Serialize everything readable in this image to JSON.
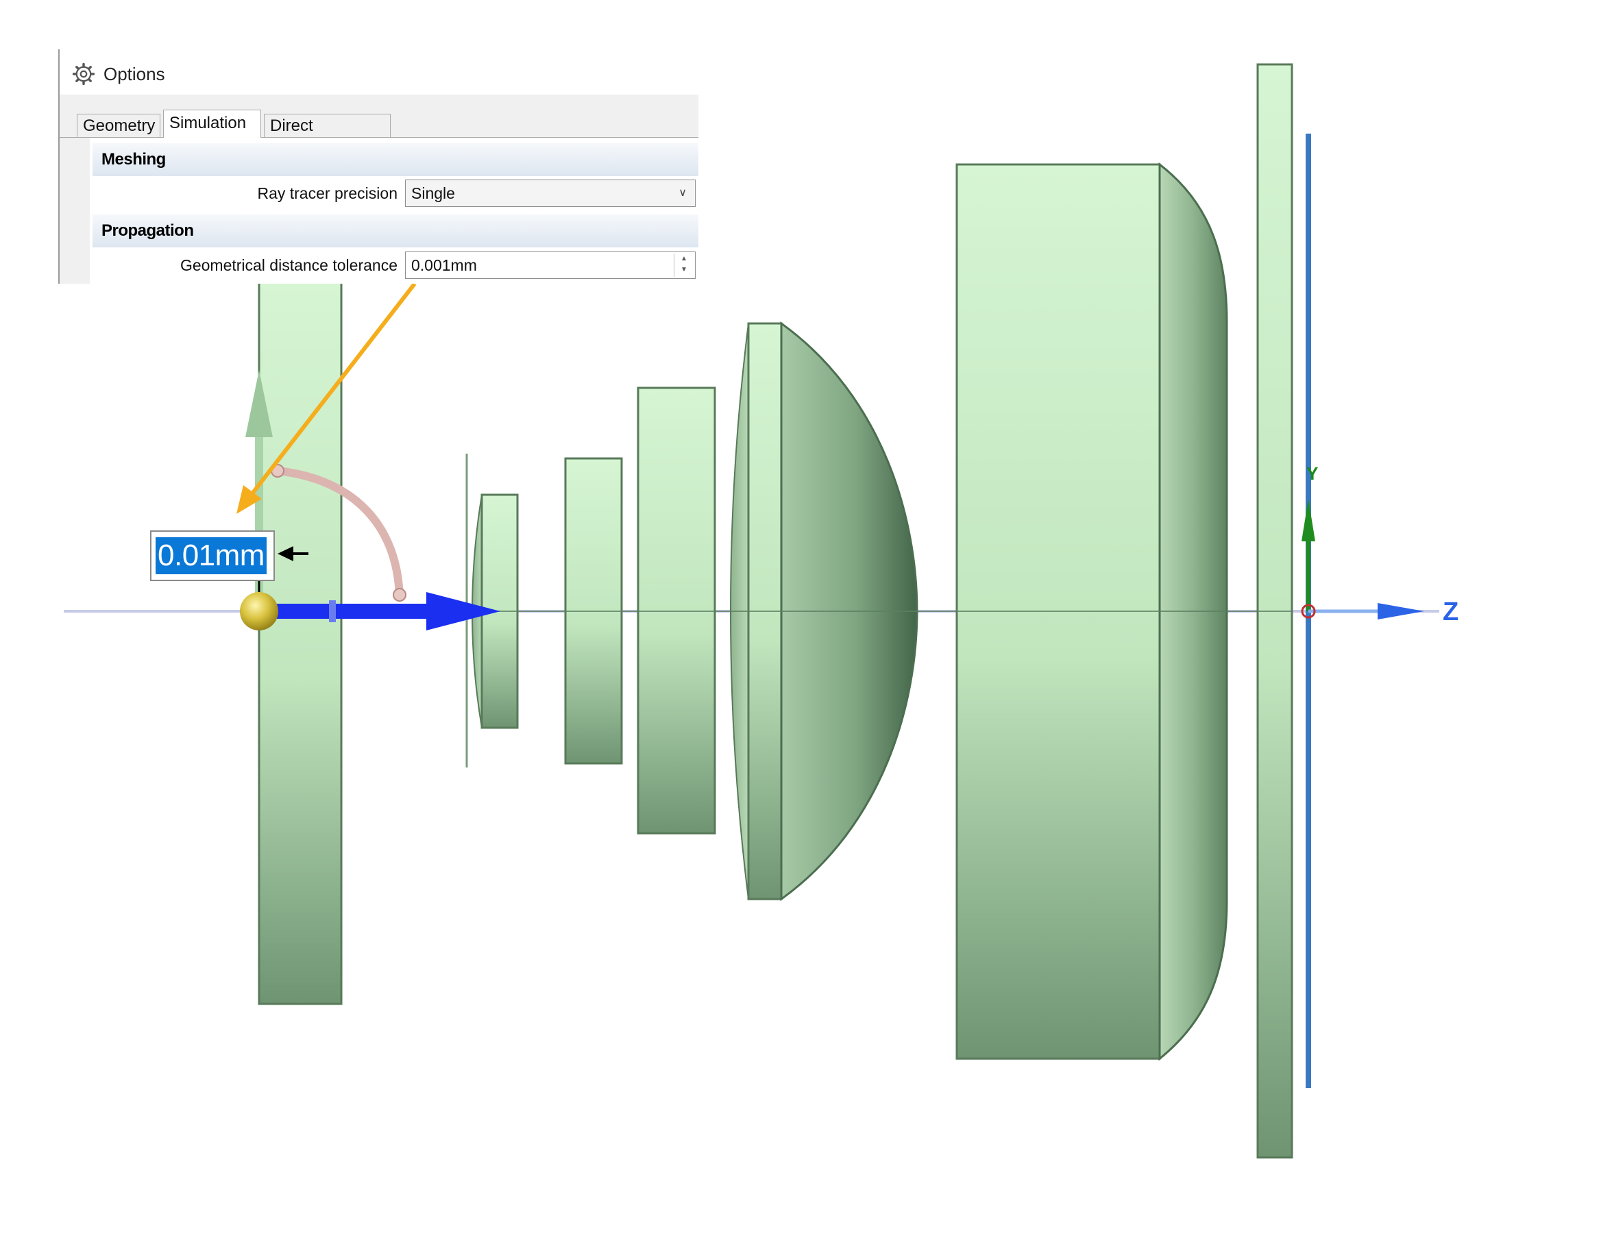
{
  "options_panel": {
    "title": "Options",
    "tabs": [
      {
        "label": "Geometry",
        "active": false
      },
      {
        "label": "Simulation",
        "active": true
      },
      {
        "label": "Direct simulation",
        "active": false
      }
    ],
    "sections": {
      "meshing": {
        "header": "Meshing",
        "ray_tracer_precision": {
          "label": "Ray tracer precision",
          "value": "Single"
        }
      },
      "propagation": {
        "header": "Propagation",
        "geometrical_distance_tolerance": {
          "label": "Geometrical distance tolerance",
          "value": "0.001mm"
        }
      }
    }
  },
  "viewport": {
    "dimension_label": "0.01mm",
    "axis_z_label": "Z",
    "axis_y_label": "Y",
    "colors": {
      "lens": "#c9ecc6",
      "lens_shaded": "#5f8a62",
      "axis_z": "#1a2ff0",
      "axis_y": "#1e8c1e",
      "annotation_arrow": "#f5ad1c",
      "vertical_line": "#3a78c2"
    }
  }
}
